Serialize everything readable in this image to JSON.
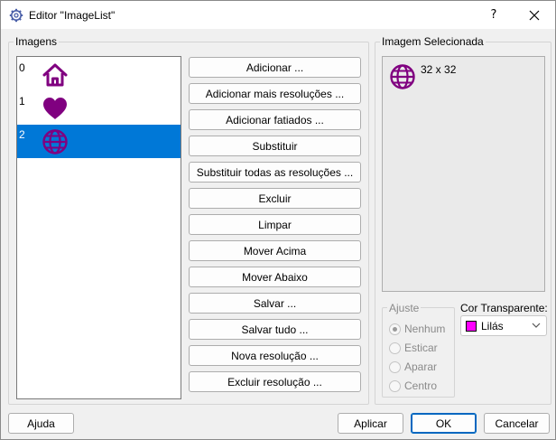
{
  "window": {
    "title": "Editor \"ImageList\"",
    "help_glyph": "?",
    "close_glyph": "✕",
    "icon": "gear-icon"
  },
  "images_group": {
    "label": "Imagens",
    "items": [
      {
        "index": "0",
        "icon": "home-icon",
        "selected": false
      },
      {
        "index": "1",
        "icon": "heart-icon",
        "selected": false
      },
      {
        "index": "2",
        "icon": "globe-icon",
        "selected": true
      }
    ]
  },
  "actions": [
    "Adicionar ...",
    "Adicionar mais resoluções ...",
    "Adicionar fatiados ...",
    "Substituir",
    "Substituir todas as resoluções ...",
    "Excluir",
    "Limpar",
    "Mover Acima",
    "Mover Abaixo",
    "Salvar ...",
    "Salvar tudo ...",
    "Nova resolução ...",
    "Excluir resolução ..."
  ],
  "selected_group": {
    "label": "Imagem Selecionada",
    "size_text": "32 x 32",
    "icon": "globe-icon"
  },
  "adjust": {
    "label": "Ajuste",
    "options": [
      "Nenhum",
      "Esticar",
      "Aparar",
      "Centro"
    ],
    "selected": "Nenhum"
  },
  "transparent": {
    "label": "Cor Transparente:",
    "value": "Lilás",
    "color": "#ff00ff"
  },
  "footer": {
    "help": "Ajuda",
    "apply": "Aplicar",
    "ok": "OK",
    "cancel": "Cancelar"
  },
  "colors": {
    "icon_purple": "#800080",
    "selection_blue": "#0078d7"
  }
}
